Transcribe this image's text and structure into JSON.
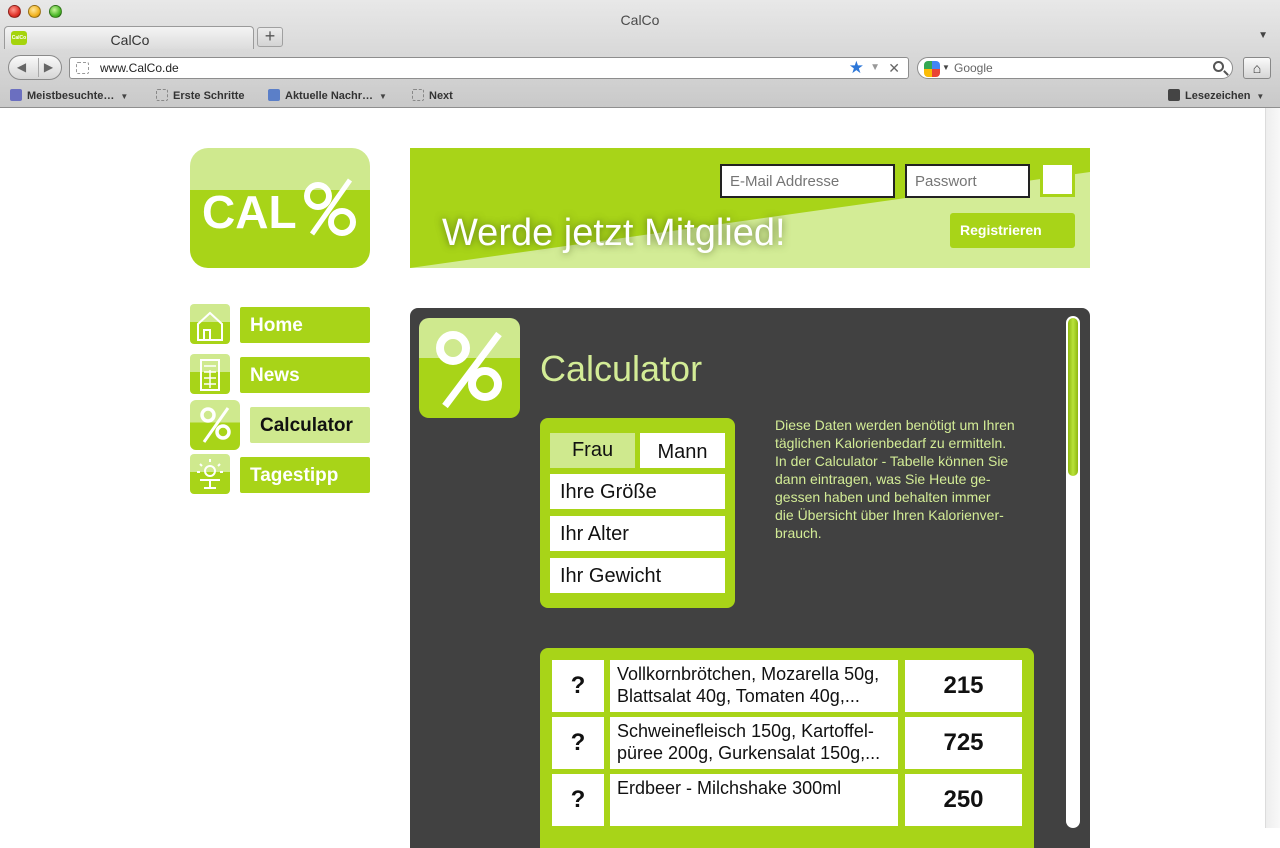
{
  "browser": {
    "window_title": "CalCo",
    "tab_title": "CalCo",
    "tab_favicon": "CalCo",
    "new_tab_label": "+",
    "url": "www.CalCo.de",
    "search_placeholder": "Google",
    "bookmarks": [
      "Meistbesuchte…",
      "Erste Schritte",
      "Aktuelle Nachr…",
      "Next"
    ],
    "reading_list": "Lesezeichen"
  },
  "site": {
    "logo_text": "CAL%",
    "brand_colors": {
      "green": "#a8d418",
      "light_green": "#cfe98e",
      "panel": "#414141"
    }
  },
  "header": {
    "slogan": "Werde jetzt Mitglied!",
    "email_placeholder": "E-Mail Addresse",
    "password_placeholder": "Passwort",
    "register_label": "Registrieren"
  },
  "nav": {
    "items": [
      {
        "label": "Home",
        "icon": "house-icon"
      },
      {
        "label": "News",
        "icon": "calculator-keys-icon"
      },
      {
        "label": "Calculator",
        "icon": "percent-icon",
        "active": true
      },
      {
        "label": "Tagestipp",
        "icon": "sun-icon"
      }
    ]
  },
  "calculator": {
    "title": "Calculator",
    "gender": {
      "female": "Frau",
      "male": "Mann",
      "selected": "Frau"
    },
    "fields": [
      "Ihre Größe",
      "Ihr Alter",
      "Ihr Gewicht"
    ],
    "info_lines": [
      "Diese Daten werden benötigt um Ihren",
      "täglichen Kalorienbedarf zu ermitteln.",
      "In der Calculator - Tabelle können Sie",
      "dann eintragen, was Sie Heute ge-",
      "gessen haben und behalten immer",
      "die Übersicht über Ihren Kalorienver-",
      "brauch."
    ],
    "meals": [
      {
        "q": "?",
        "line1": "Vollkornbrötchen, Mozarella 50g,",
        "line2": "Blattsalat 40g, Tomaten 40g,...",
        "kcal": "215"
      },
      {
        "q": "?",
        "line1": "Schweinefleisch 150g, Kartoffel-",
        "line2": "püree 200g, Gurkensalat 150g,...",
        "kcal": "725"
      },
      {
        "q": "?",
        "line1": "Erdbeer - Milchshake 300ml",
        "line2": "",
        "kcal": "250"
      }
    ]
  }
}
